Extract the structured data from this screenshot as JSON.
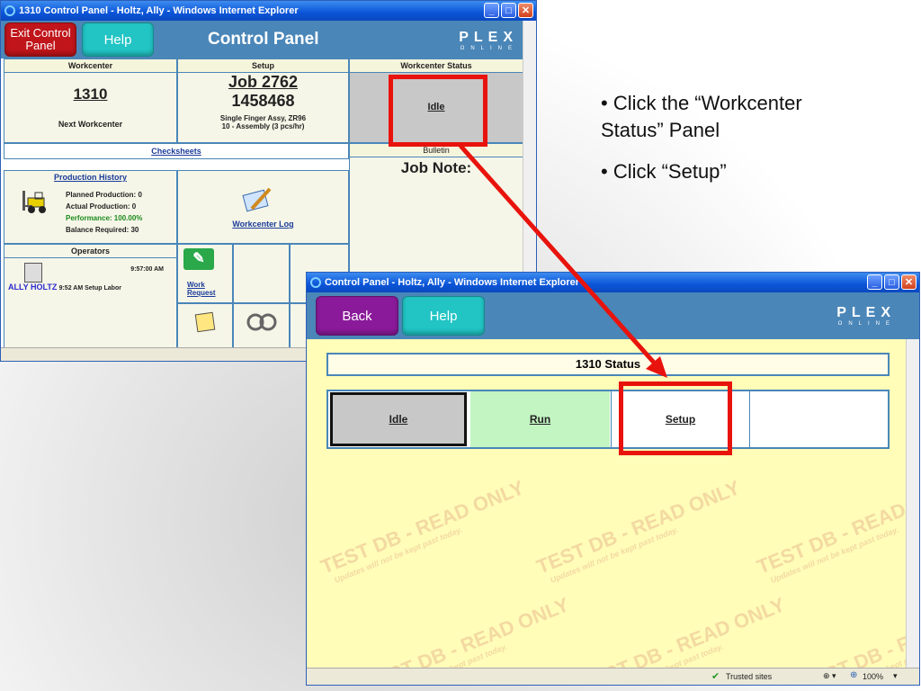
{
  "win1": {
    "title": "1310 Control Panel - Holtz, Ally - Windows Internet Explorer",
    "exit_label": "Exit Control Panel",
    "help_label": "Help",
    "header_title": "Control Panel",
    "logo_word": "PLEX",
    "logo_sub": "ONLINE",
    "workcenter": {
      "header": "Workcenter",
      "number": "1310",
      "next": "Next Workcenter"
    },
    "setup": {
      "header": "Setup",
      "job": "Job 2762",
      "part": "1458468",
      "desc1": "Single Finger Assy, ZR96",
      "desc2": "10 - Assembly  (3 pcs/hr)"
    },
    "status": {
      "header": "Workcenter Status",
      "value": "Idle"
    },
    "checksheets": "Checksheets",
    "bulletin": {
      "header": "Bulletin",
      "note": "Job Note:"
    },
    "production": {
      "title": "Production History",
      "planned": "Planned Production: 0",
      "actual": "Actual Production: 0",
      "performance": "Performance: 100.00%",
      "balance": "Balance Required:  30"
    },
    "workcenter_log": "Workcenter Log",
    "operators": {
      "header": "Operators",
      "time": "9:57:00 AM",
      "name": "ALLY HOLTZ",
      "detail": "9:52 AM Setup Labor"
    },
    "work_request": "Work Request"
  },
  "win2": {
    "title": "Control Panel - Holtz, Ally - Windows Internet Explorer",
    "back_label": "Back",
    "help_label": "Help",
    "logo_word": "PLEX",
    "logo_sub": "ONLINE",
    "status_title": "1310 Status",
    "options": [
      "Idle",
      "Run",
      "Setup",
      ""
    ],
    "watermark_main": "TEST DB - READ ONLY",
    "watermark_sub": "Updates will not be kept past today.",
    "statusbar": {
      "trusted": "Trusted sites",
      "zoom": "100%"
    }
  },
  "instructions": [
    "• Click the “Workcenter Status” Panel",
    "• Click “Setup”"
  ],
  "colors": {
    "header_blue": "#4a86b8",
    "exit_red": "#c0151a",
    "help_teal": "#22c4c4",
    "back_purple": "#8a1a9a",
    "highlight_red": "#e8130c",
    "run_green": "#c2f5c2"
  }
}
